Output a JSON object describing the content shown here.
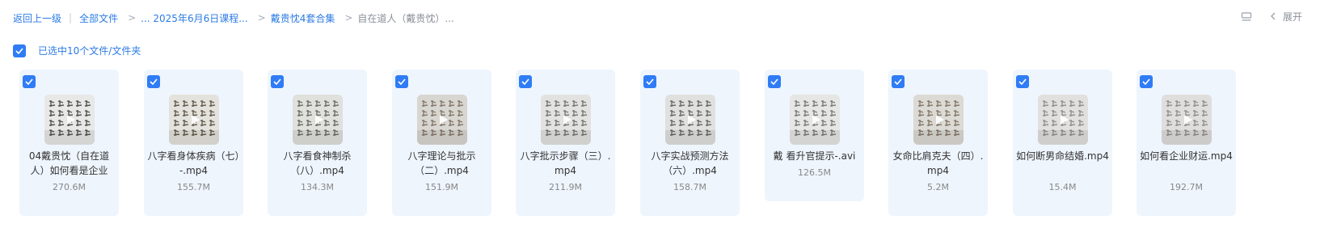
{
  "breadcrumb": {
    "back": "返回上一级",
    "all_files": "全部文件",
    "crumb1": "... 2025年6月6日课程...",
    "crumb2": "戴贵忱4套合集",
    "current": "自在道人（戴贵忱）..."
  },
  "toolbar": {
    "expand_label": "展开"
  },
  "selection": {
    "text": "已选中10个文件/文件夹"
  },
  "files": [
    {
      "name": "04戴贵忱（自在道人）如何看是企业",
      "size": "270.6M"
    },
    {
      "name": "八字看身体疾病（七）-.mp4",
      "size": "155.7M"
    },
    {
      "name": "八字看食神制杀（八）.mp4",
      "size": "134.3M"
    },
    {
      "name": "八字理论与批示（二）.mp4",
      "size": "151.9M"
    },
    {
      "name": "八字批示步骤（三）.mp4",
      "size": "211.9M"
    },
    {
      "name": "八字实战预测方法（六）.mp4",
      "size": "158.7M"
    },
    {
      "name": "戴 看升官提示-.avi",
      "size": "126.5M"
    },
    {
      "name": "女命比肩克夫（四）.mp4",
      "size": "5.2M"
    },
    {
      "name": "如何断男命结婚.mp4",
      "size": "15.4M"
    },
    {
      "name": "如何看企业财运.mp4",
      "size": "192.7M"
    }
  ],
  "colors": {
    "accent": "#2f7cf6",
    "card_bg": "#eef5fd",
    "link": "#2c7be5"
  }
}
